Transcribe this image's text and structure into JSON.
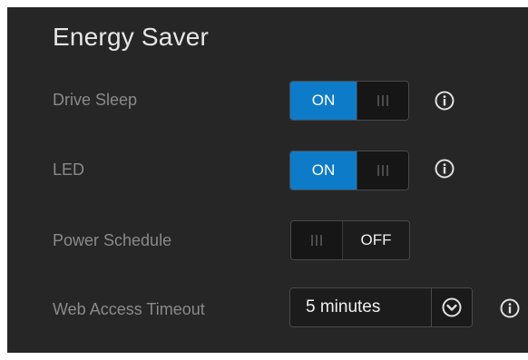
{
  "section": {
    "title": "Energy Saver"
  },
  "settings": {
    "drive_sleep": {
      "label": "Drive Sleep",
      "state": "ON"
    },
    "led": {
      "label": "LED",
      "state": "ON"
    },
    "power_schedule": {
      "label": "Power Schedule",
      "state": "OFF"
    },
    "web_access_timeout": {
      "label": "Web Access Timeout",
      "value": "5 minutes"
    }
  },
  "icons": {
    "info": "info-circle-icon",
    "dropdown": "chevron-down-circle-icon"
  },
  "colors": {
    "background": "#262626",
    "toggle_on": "#0e7bc8",
    "label_text": "#8a8a8a",
    "title_text": "#e6e6e6"
  }
}
